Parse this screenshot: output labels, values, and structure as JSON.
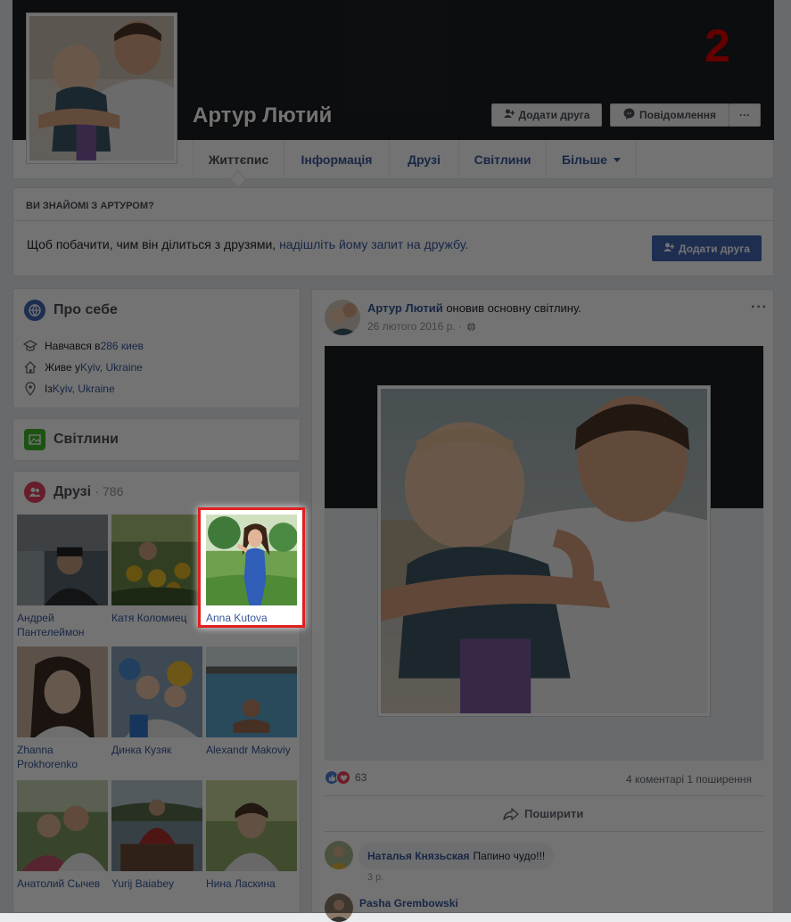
{
  "marker": "2",
  "profile": {
    "name": "Артур Лютий",
    "add_friend_label": "Додати друга",
    "message_label": "Повідомлення",
    "more_label": "···"
  },
  "tabs": [
    {
      "label": "Життєпис"
    },
    {
      "label": "Інформація"
    },
    {
      "label": "Друзі"
    },
    {
      "label": "Світлини"
    },
    {
      "label": "Більше"
    }
  ],
  "know": {
    "heading": "ВИ ЗНАЙОМІ З АРТУРОМ?",
    "text_before": "Щоб побачити, чим він ділиться з друзями, ",
    "link": "надішліть йому запит на дружбу.",
    "button": "Додати друга"
  },
  "about": {
    "title": "Про себе",
    "rows": [
      {
        "prefix": "Навчався в ",
        "link": "286 киев",
        "icon": "graduation-cap-icon"
      },
      {
        "prefix": "Живе у ",
        "link": "Kyiv, Ukraine",
        "icon": "home-icon"
      },
      {
        "prefix": "Із ",
        "link": "Kyiv, Ukraine",
        "icon": "location-pin-icon"
      }
    ]
  },
  "photos_card": {
    "title": "Світлини"
  },
  "friends": {
    "title": "Друзі",
    "count": "· 786",
    "list": [
      {
        "name": "Андрей Пантелеймон"
      },
      {
        "name": "Катя Коломиец"
      },
      {
        "name": "Anna Kutova"
      },
      {
        "name": "Zhanna Prokhorenko"
      },
      {
        "name": "Динка Кузяк"
      },
      {
        "name": "Alexandr Makoviy"
      },
      {
        "name": "Анатолий Сычев"
      },
      {
        "name": "Yurij Baiabey"
      },
      {
        "name": "Нина Ласкина"
      }
    ]
  },
  "post": {
    "author": "Артур Лютий",
    "action": " оновив основну світлину.",
    "date": "26 лютого 2016 р. ·",
    "more": "···",
    "reactions_count": "63",
    "stats": "4 коментарі   1 поширення",
    "share_label": "Поширити",
    "comments": [
      {
        "author": "Наталья Князьская",
        "text": "Папино чудо!!!",
        "time": "3 р."
      },
      {
        "author": "Pasha Grembowski"
      }
    ]
  },
  "colors": {
    "accent": "#4267b2",
    "link": "#365899",
    "highlight": "#e02020"
  }
}
